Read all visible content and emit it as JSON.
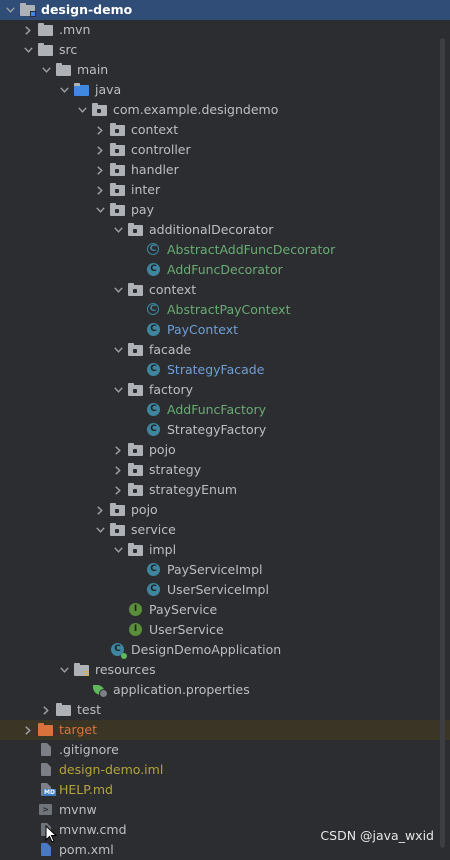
{
  "tree": [
    {
      "label": "design-demo",
      "depth": 0,
      "arrow": "down",
      "icon": "module-folder-icon",
      "color": "#ffffff",
      "selected": true
    },
    {
      "label": ".mvn",
      "depth": 1,
      "arrow": "right",
      "icon": "folder-icon",
      "color": "#bcbec4"
    },
    {
      "label": "src",
      "depth": 1,
      "arrow": "down",
      "icon": "folder-icon",
      "color": "#bcbec4"
    },
    {
      "label": "main",
      "depth": 2,
      "arrow": "down",
      "icon": "folder-icon",
      "color": "#bcbec4"
    },
    {
      "label": "java",
      "depth": 3,
      "arrow": "down",
      "icon": "source-folder-icon",
      "color": "#bcbec4"
    },
    {
      "label": "com.example.designdemo",
      "depth": 4,
      "arrow": "down",
      "icon": "package-icon",
      "color": "#bcbec4"
    },
    {
      "label": "context",
      "depth": 5,
      "arrow": "right",
      "icon": "package-icon",
      "color": "#bcbec4"
    },
    {
      "label": "controller",
      "depth": 5,
      "arrow": "right",
      "icon": "package-icon",
      "color": "#bcbec4"
    },
    {
      "label": "handler",
      "depth": 5,
      "arrow": "right",
      "icon": "package-icon",
      "color": "#bcbec4"
    },
    {
      "label": "inter",
      "depth": 5,
      "arrow": "right",
      "icon": "package-icon",
      "color": "#bcbec4"
    },
    {
      "label": "pay",
      "depth": 5,
      "arrow": "down",
      "icon": "package-icon",
      "color": "#bcbec4"
    },
    {
      "label": "additionalDecorator",
      "depth": 6,
      "arrow": "down",
      "icon": "package-icon",
      "color": "#bcbec4"
    },
    {
      "label": "AbstractAddFuncDecorator",
      "depth": 7,
      "arrow": "none",
      "icon": "abstract-class-icon",
      "color": "#6aab73"
    },
    {
      "label": "AddFuncDecorator",
      "depth": 7,
      "arrow": "none",
      "icon": "class-icon",
      "color": "#6aab73"
    },
    {
      "label": "context",
      "depth": 6,
      "arrow": "down",
      "icon": "package-icon",
      "color": "#bcbec4"
    },
    {
      "label": "AbstractPayContext",
      "depth": 7,
      "arrow": "none",
      "icon": "abstract-class-icon",
      "color": "#6aab73"
    },
    {
      "label": "PayContext",
      "depth": 7,
      "arrow": "none",
      "icon": "class-icon",
      "color": "#6f9fd8"
    },
    {
      "label": "facade",
      "depth": 6,
      "arrow": "down",
      "icon": "package-icon",
      "color": "#bcbec4"
    },
    {
      "label": "StrategyFacade",
      "depth": 7,
      "arrow": "none",
      "icon": "class-icon",
      "color": "#6f9fd8"
    },
    {
      "label": "factory",
      "depth": 6,
      "arrow": "down",
      "icon": "package-icon",
      "color": "#bcbec4"
    },
    {
      "label": "AddFuncFactory",
      "depth": 7,
      "arrow": "none",
      "icon": "class-icon",
      "color": "#6aab73"
    },
    {
      "label": "StrategyFactory",
      "depth": 7,
      "arrow": "none",
      "icon": "class-icon",
      "color": "#bcbec4"
    },
    {
      "label": "pojo",
      "depth": 6,
      "arrow": "right",
      "icon": "package-icon",
      "color": "#bcbec4"
    },
    {
      "label": "strategy",
      "depth": 6,
      "arrow": "right",
      "icon": "package-icon",
      "color": "#bcbec4"
    },
    {
      "label": "strategyEnum",
      "depth": 6,
      "arrow": "right",
      "icon": "package-icon",
      "color": "#bcbec4"
    },
    {
      "label": "pojo",
      "depth": 5,
      "arrow": "right",
      "icon": "package-icon",
      "color": "#bcbec4"
    },
    {
      "label": "service",
      "depth": 5,
      "arrow": "down",
      "icon": "package-icon",
      "color": "#bcbec4"
    },
    {
      "label": "impl",
      "depth": 6,
      "arrow": "down",
      "icon": "package-icon",
      "color": "#bcbec4"
    },
    {
      "label": "PayServiceImpl",
      "depth": 7,
      "arrow": "none",
      "icon": "class-icon",
      "color": "#bcbec4"
    },
    {
      "label": "UserServiceImpl",
      "depth": 7,
      "arrow": "none",
      "icon": "class-icon",
      "color": "#bcbec4"
    },
    {
      "label": "PayService",
      "depth": 6,
      "arrow": "none",
      "icon": "interface-icon",
      "color": "#bcbec4"
    },
    {
      "label": "UserService",
      "depth": 6,
      "arrow": "none",
      "icon": "interface-icon",
      "color": "#bcbec4"
    },
    {
      "label": "DesignDemoApplication",
      "depth": 5,
      "arrow": "none",
      "icon": "spring-class-icon",
      "color": "#bcbec4"
    },
    {
      "label": "resources",
      "depth": 3,
      "arrow": "down",
      "icon": "resources-folder-icon",
      "color": "#bcbec4"
    },
    {
      "label": "application.properties",
      "depth": 4,
      "arrow": "none",
      "icon": "spring-properties-icon",
      "color": "#bcbec4"
    },
    {
      "label": "test",
      "depth": 2,
      "arrow": "right",
      "icon": "folder-icon",
      "color": "#bcbec4"
    },
    {
      "label": "target",
      "depth": 1,
      "arrow": "right",
      "icon": "excluded-folder-icon",
      "color": "#d9733b",
      "excluded": true
    },
    {
      "label": ".gitignore",
      "depth": 1,
      "arrow": "none",
      "icon": "gitignore-file-icon",
      "color": "#bcbec4"
    },
    {
      "label": "design-demo.iml",
      "depth": 1,
      "arrow": "none",
      "icon": "iml-file-icon",
      "color": "#b6a33a"
    },
    {
      "label": "HELP.md",
      "depth": 1,
      "arrow": "none",
      "icon": "markdown-file-icon",
      "color": "#b6a33a"
    },
    {
      "label": "mvnw",
      "depth": 1,
      "arrow": "none",
      "icon": "shell-file-icon",
      "color": "#bcbec4"
    },
    {
      "label": "mvnw.cmd",
      "depth": 1,
      "arrow": "none",
      "icon": "cmd-file-icon",
      "color": "#bcbec4"
    },
    {
      "label": "pom.xml",
      "depth": 1,
      "arrow": "none",
      "icon": "maven-file-icon",
      "color": "#bcbec4"
    }
  ],
  "watermark": "CSDN @java_wxid"
}
